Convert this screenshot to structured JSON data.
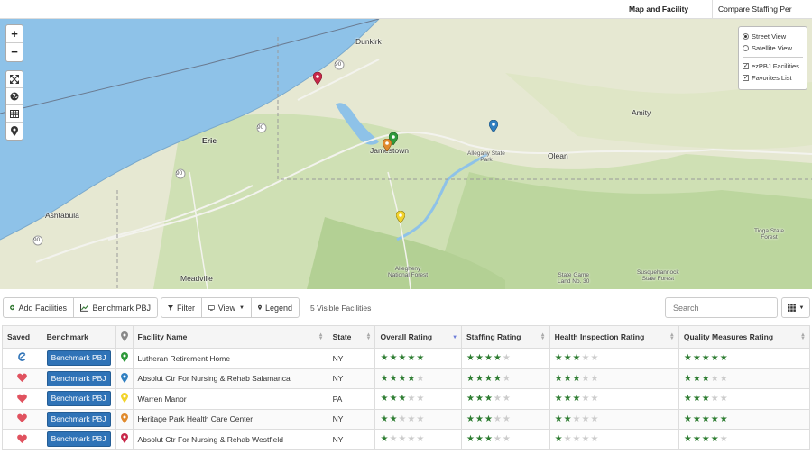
{
  "top_tabs": [
    {
      "label": "Map and Facility Search"
    },
    {
      "label": "Compare Staffing Per Facility"
    }
  ],
  "map": {
    "zoom_in": "+",
    "zoom_out": "−",
    "tool_icons": [
      "expand-icon",
      "globe-icon",
      "table-icon",
      "map-pin-icon"
    ],
    "layers": {
      "street_view": "Street View",
      "satellite_view": "Satellite View",
      "ezpbj": "ezPBJ Facilities",
      "favorites": "Favorites List"
    },
    "labels": {
      "dunkirk": "Dunkirk",
      "erie": "Erie",
      "jamestown": "Jamestown",
      "olean": "Olean",
      "amity": "Amity",
      "ashtabula": "Ashtabula",
      "meadville": "Meadville",
      "allegany_park": "Allegany State\nPark",
      "allegheny_forest": "Allegheny\nNational Forest",
      "tioga_forest": "Tioga State\nForest",
      "game_land": "State Game\nLand No. 30",
      "susquehannock": "Susquehannock\nState Forest",
      "r90a": "90",
      "r90b": "90",
      "r90c": "90",
      "r90d": "90"
    },
    "marker_colors": {
      "red": "#c8284a",
      "green": "#2e9a3a",
      "blue": "#2f7fc1",
      "orange": "#e08a2c",
      "yellow": "#f2d32c"
    }
  },
  "toolbar": {
    "add_facilities": "Add Facilities",
    "benchmark_pbj": "Benchmark PBJ",
    "filter": "Filter",
    "view": "View",
    "legend": "Legend",
    "visible_count": "5 Visible Facilities",
    "search_placeholder": "Search"
  },
  "table": {
    "headers": {
      "saved": "Saved",
      "benchmark": "Benchmark",
      "facility": "Facility Name",
      "state": "State",
      "overall": "Overall Rating",
      "staffing": "Staffing Rating",
      "health": "Health Inspection Rating",
      "quality": "Quality Measures Rating"
    },
    "rows": [
      {
        "saved": "ezpbj-icon",
        "benchmark": "Benchmark PBJ",
        "pin": "#2e9a3a",
        "facility": "Lutheran Retirement Home",
        "state": "NY",
        "overall": 5,
        "staffing": 4,
        "health": 3,
        "quality": 5
      },
      {
        "saved": "heart-icon",
        "benchmark": "Benchmark PBJ",
        "pin": "#2f7fc1",
        "facility": "Absolut Ctr For Nursing & Rehab Salamanca",
        "state": "NY",
        "overall": 4,
        "staffing": 4,
        "health": 3,
        "quality": 3
      },
      {
        "saved": "heart-icon",
        "benchmark": "Benchmark PBJ",
        "pin": "#f2d32c",
        "facility": "Warren Manor",
        "state": "PA",
        "overall": 3,
        "staffing": 3,
        "health": 3,
        "quality": 3
      },
      {
        "saved": "heart-icon",
        "benchmark": "Benchmark PBJ",
        "pin": "#e08a2c",
        "facility": "Heritage Park Health Care Center",
        "state": "NY",
        "overall": 2,
        "staffing": 3,
        "health": 2,
        "quality": 5
      },
      {
        "saved": "heart-icon",
        "benchmark": "Benchmark PBJ",
        "pin": "#c8284a",
        "facility": "Absolut Ctr For Nursing & Rehab Westfield",
        "state": "NY",
        "overall": 1,
        "staffing": 3,
        "health": 1,
        "quality": 4
      }
    ]
  }
}
